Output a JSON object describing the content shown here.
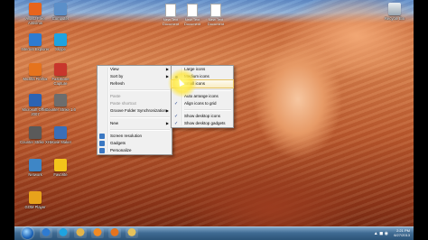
{
  "desktop_icons_left": [
    {
      "label": "Avast! Free Antivirus",
      "color": "#e8641c"
    },
    {
      "label": "Computer",
      "color": "#5b8fc9"
    },
    {
      "label": "Internet Explorer",
      "color": "#2e7bd1"
    },
    {
      "label": "Skype",
      "color": "#1ea3e0"
    },
    {
      "label": "Mozilla Firefox",
      "color": "#e5731d"
    },
    {
      "label": "FastStone Capture",
      "color": "#c8362c"
    },
    {
      "label": "Microsoft Office 2007",
      "color": "#2c63b3"
    },
    {
      "label": "Counter Strike 1.6",
      "color": "#6d6d6d"
    },
    {
      "label": "Counter Strike XH",
      "color": "#5a5a5a"
    },
    {
      "label": "Movie Maker",
      "color": "#3a6fb8"
    },
    {
      "label": "Network",
      "color": "#3e86c6"
    },
    {
      "label": "Favorite",
      "color": "#f3c41a"
    },
    {
      "label": "GOM Player",
      "color": "#e8a21b"
    }
  ],
  "desktop_files": [
    {
      "label": "New Text Document"
    },
    {
      "label": "New Text Document"
    },
    {
      "label": "New Text Document"
    }
  ],
  "recycle_bin": {
    "label": "Recycle Bin"
  },
  "context_menu": {
    "items": [
      {
        "label": "View",
        "has_submenu": true
      },
      {
        "label": "Sort by",
        "has_submenu": true
      },
      {
        "label": "Refresh"
      },
      {
        "sep": true
      },
      {
        "label": "Paste",
        "disabled": true
      },
      {
        "label": "Paste shortcut",
        "disabled": true
      },
      {
        "label": "Groove Folder Synchronization",
        "has_submenu": true
      },
      {
        "sep": true
      },
      {
        "label": "New",
        "has_submenu": true
      },
      {
        "sep": true
      },
      {
        "label": "Screen resolution",
        "icon": "screen-resolution-icon"
      },
      {
        "label": "Gadgets",
        "icon": "gadgets-icon"
      },
      {
        "label": "Personalize",
        "icon": "personalize-icon"
      }
    ]
  },
  "view_submenu": {
    "items": [
      {
        "label": "Large icons"
      },
      {
        "label": "Medium icons",
        "bullet": true
      },
      {
        "label": "Small icons",
        "highlighted": true
      },
      {
        "sep": true
      },
      {
        "label": "Auto arrange icons"
      },
      {
        "label": "Align icons to grid",
        "checked": true
      },
      {
        "sep": true
      },
      {
        "label": "Show desktop icons",
        "checked": true
      },
      {
        "label": "Show desktop gadgets",
        "checked": true
      }
    ]
  },
  "taskbar": {
    "pinned": [
      {
        "name": "ie-taskbar-icon",
        "color": "#2e7bd1"
      },
      {
        "name": "skype-taskbar-icon",
        "color": "#1ea3e0"
      },
      {
        "name": "explorer-taskbar-icon",
        "color": "#e3b54a"
      },
      {
        "name": "wmp-taskbar-icon",
        "color": "#f08a24"
      },
      {
        "name": "firefox-taskbar-icon",
        "color": "#e5731d"
      },
      {
        "name": "folder-taskbar-icon",
        "color": "#e6c25a"
      }
    ],
    "time": "2:21 PM",
    "date": "6/27/2013"
  }
}
